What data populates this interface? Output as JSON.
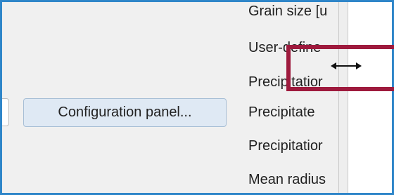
{
  "left_panel": {
    "config_button_label": "Configuration panel..."
  },
  "labels": [
    {
      "text": "Grain size [u"
    },
    {
      "text": "User-define"
    },
    {
      "text": "Precipitatior"
    },
    {
      "text": "Precipitate"
    },
    {
      "text": "Precipitatior"
    },
    {
      "text": "Mean radius"
    }
  ],
  "cursor": {
    "icon": "horizontal-resize-icon"
  },
  "colors": {
    "window_border": "#2f86c9",
    "highlight_border": "#9e1a3d",
    "button_bg": "#dfe9f4"
  }
}
